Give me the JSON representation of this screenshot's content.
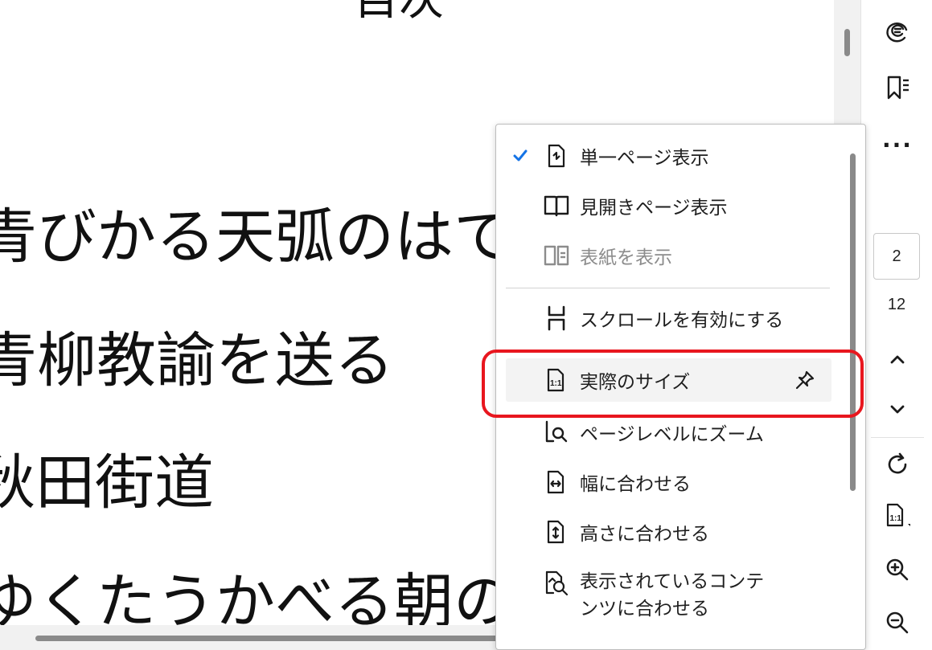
{
  "document": {
    "title_fragment": "目次",
    "lines": [
      "青びかる天弧のはて",
      "青柳教諭を送る",
      "秋田街道",
      "ゆくたうかべる朝の"
    ]
  },
  "toolbar": {
    "page_current": "2",
    "page_total": "12",
    "more_label": "···",
    "icons": [
      "ai-assistant-icon",
      "bookmark-list-icon",
      "more-icon",
      "chevron-up-icon",
      "chevron-down-icon",
      "rotate-icon",
      "actual-size-icon",
      "zoom-in-icon",
      "zoom-out-icon"
    ]
  },
  "menu": {
    "items": [
      {
        "label": "単一ページ表示",
        "checked": true,
        "icon": "single-page-icon"
      },
      {
        "label": "見開きページ表示",
        "checked": false,
        "icon": "two-page-icon"
      },
      {
        "label": "表紙を表示",
        "checked": false,
        "disabled": true,
        "icon": "cover-page-icon"
      },
      {
        "label": "スクロールを有効にする",
        "checked": false,
        "icon": "scroll-icon"
      },
      {
        "label": "実際のサイズ",
        "checked": false,
        "icon": "actual-size-icon",
        "pinnable": true
      },
      {
        "label": "ページレベルにズーム",
        "checked": false,
        "icon": "page-zoom-icon"
      },
      {
        "label": "幅に合わせる",
        "checked": false,
        "icon": "fit-width-icon"
      },
      {
        "label": "高さに合わせる",
        "checked": false,
        "icon": "fit-height-icon"
      },
      {
        "label": "表示されているコンテンツに合わせる",
        "checked": false,
        "icon": "fit-visible-icon"
      }
    ]
  },
  "colors": {
    "accent": "#1473e6",
    "highlight": "#e8161e",
    "disabled": "#8c8c8c"
  }
}
